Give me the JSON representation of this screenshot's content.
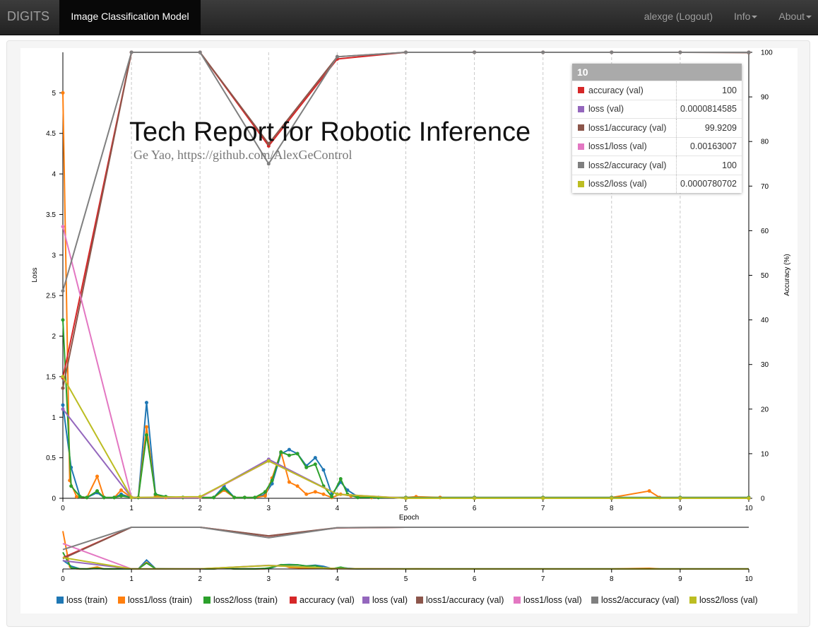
{
  "navbar": {
    "brand": "DIGITS",
    "active_tab": "Image Classification Model",
    "user": "alexge (Logout)",
    "info": "Info",
    "about": "About"
  },
  "overlay": {
    "title": "Tech Report for Robotic Inference",
    "subtitle": "Ge Yao, https://github.com/AlexGeControl"
  },
  "tooltip": {
    "header": "10",
    "rows": [
      {
        "name": "accuracy (val)",
        "value": "100",
        "color": "#d62728"
      },
      {
        "name": "loss (val)",
        "value": "0.0000814585",
        "color": "#9467bd"
      },
      {
        "name": "loss1/accuracy (val)",
        "value": "99.9209",
        "color": "#8c564b"
      },
      {
        "name": "loss1/loss (val)",
        "value": "0.00163007",
        "color": "#e377c2"
      },
      {
        "name": "loss2/accuracy (val)",
        "value": "100",
        "color": "#7f7f7f"
      },
      {
        "name": "loss2/loss (val)",
        "value": "0.0000780702",
        "color": "#bcbd22"
      }
    ]
  },
  "chart_data": {
    "type": "line",
    "xlabel": "Epoch",
    "ylabel": "Loss",
    "y2label": "Accuracy (%)",
    "xlim": [
      0,
      10
    ],
    "ylim": [
      0,
      5.5
    ],
    "y2lim": [
      0,
      100
    ],
    "x_ticks": [
      "0",
      "1",
      "2",
      "3",
      "4",
      "5",
      "6",
      "7",
      "8",
      "9",
      "10"
    ],
    "y_ticks": [
      "0",
      "0.5",
      "1",
      "1.5",
      "2",
      "2.5",
      "3",
      "3.5",
      "4",
      "4.5",
      "5"
    ],
    "y2_ticks": [
      "0",
      "10",
      "20",
      "30",
      "40",
      "50",
      "60",
      "70",
      "80",
      "90",
      "100"
    ],
    "grid": "vertical dashed",
    "legend": "bottom",
    "series": [
      {
        "name": "loss (train)",
        "axis": "left",
        "color": "#1f77b4",
        "x": [
          0,
          0.12,
          0.25,
          0.35,
          0.5,
          0.6,
          0.75,
          0.85,
          1,
          1.1,
          1.22,
          1.35,
          1.5,
          1.75,
          2,
          2.2,
          2.35,
          2.5,
          2.65,
          2.8,
          2.95,
          3.05,
          3.18,
          3.3,
          3.42,
          3.55,
          3.68,
          3.8,
          3.92,
          4.05,
          4.15,
          4.3,
          4.6,
          5,
          5.5,
          6,
          7,
          8,
          9,
          10
        ],
        "y": [
          1.15,
          0.38,
          0.02,
          0.01,
          0.07,
          0.01,
          0.01,
          0.05,
          0.01,
          0.01,
          1.18,
          0.05,
          0.02,
          0.01,
          0.01,
          0.01,
          0.15,
          0.01,
          0.01,
          0.01,
          0.05,
          0.18,
          0.55,
          0.6,
          0.55,
          0.4,
          0.5,
          0.35,
          0.05,
          0.2,
          0.1,
          0.02,
          0.01,
          0.01,
          0.01,
          0.01,
          0.01,
          0.01,
          0.01,
          0.01
        ]
      },
      {
        "name": "loss1/loss (train)",
        "axis": "left",
        "color": "#ff7f0e",
        "x": [
          0,
          0.1,
          0.2,
          0.35,
          0.5,
          0.6,
          0.75,
          0.85,
          1,
          1.1,
          1.22,
          1.35,
          1.5,
          1.75,
          2,
          2.2,
          2.35,
          2.5,
          2.65,
          2.8,
          2.95,
          3.05,
          3.18,
          3.3,
          3.42,
          3.55,
          3.68,
          3.8,
          3.92,
          4.05,
          4.2,
          4.5,
          5,
          5.15,
          5.5,
          6,
          7,
          8,
          8.55,
          8.7,
          9,
          10
        ],
        "y": [
          5,
          0.22,
          0.02,
          0.01,
          0.27,
          0.01,
          0.01,
          0.1,
          0.01,
          0.01,
          0.88,
          0.03,
          0.01,
          0.01,
          0.01,
          0.01,
          0.1,
          0.01,
          0.01,
          0.01,
          0.03,
          0.25,
          0.57,
          0.2,
          0.15,
          0.05,
          0.08,
          0.05,
          0.01,
          0.05,
          0.03,
          0.01,
          0.01,
          0.02,
          0.01,
          0.01,
          0.01,
          0.01,
          0.09,
          0.01,
          0.01,
          0.01
        ]
      },
      {
        "name": "loss2/loss (train)",
        "axis": "left",
        "color": "#2ca02c",
        "x": [
          0,
          0.12,
          0.25,
          0.35,
          0.5,
          0.6,
          0.75,
          0.85,
          1,
          1.1,
          1.22,
          1.35,
          1.5,
          1.75,
          2,
          2.2,
          2.35,
          2.5,
          2.65,
          2.8,
          2.95,
          3.05,
          3.18,
          3.3,
          3.42,
          3.55,
          3.68,
          3.8,
          3.92,
          4.05,
          4.15,
          4.3,
          4.6,
          5,
          6,
          7,
          8,
          9,
          10
        ],
        "y": [
          2.2,
          0.15,
          0.02,
          0.01,
          0.09,
          0.01,
          0.01,
          0.03,
          0.01,
          0.01,
          0.78,
          0.05,
          0.02,
          0.01,
          0.01,
          0.01,
          0.12,
          0.01,
          0.01,
          0.01,
          0.08,
          0.22,
          0.57,
          0.53,
          0.55,
          0.38,
          0.42,
          0.15,
          0.02,
          0.24,
          0.05,
          0.01,
          0.01,
          0.01,
          0.01,
          0.01,
          0.01,
          0.01,
          0.01
        ]
      },
      {
        "name": "accuracy (val)",
        "axis": "right",
        "color": "#d62728",
        "x": [
          0,
          1,
          2,
          3,
          4,
          5,
          6,
          7,
          8,
          9,
          10
        ],
        "y": [
          27,
          100,
          100,
          79,
          98.5,
          100,
          100,
          100,
          100,
          100,
          100
        ]
      },
      {
        "name": "loss (val)",
        "axis": "left",
        "color": "#9467bd",
        "x": [
          0,
          1,
          2,
          3,
          4,
          5,
          6,
          7,
          8,
          9,
          10
        ],
        "y": [
          1.1,
          0.01,
          0.01,
          0.48,
          0.05,
          0.0001,
          0.0001,
          0.0001,
          0.0001,
          0.0001,
          8.14585e-05
        ]
      },
      {
        "name": "loss1/accuracy (val)",
        "axis": "right",
        "color": "#8c564b",
        "x": [
          0,
          1,
          2,
          3,
          4,
          5,
          6,
          7,
          8,
          9,
          10
        ],
        "y": [
          24.7,
          100,
          100,
          79.5,
          99,
          100,
          100,
          100,
          100,
          100,
          99.9209
        ]
      },
      {
        "name": "loss1/loss (val)",
        "axis": "left",
        "color": "#e377c2",
        "x": [
          0,
          1,
          2,
          3,
          4,
          5,
          6,
          7,
          8,
          9,
          10
        ],
        "y": [
          3.35,
          0.01,
          0.01,
          0.46,
          0.05,
          0.002,
          0.002,
          0.002,
          0.002,
          0.002,
          0.00163007
        ]
      },
      {
        "name": "loss2/accuracy (val)",
        "axis": "right",
        "color": "#7f7f7f",
        "x": [
          0,
          1,
          2,
          3,
          4,
          5,
          6,
          7,
          8,
          9,
          10
        ],
        "y": [
          46.5,
          100,
          100,
          75,
          99,
          100,
          100,
          100,
          100,
          100,
          100
        ]
      },
      {
        "name": "loss2/loss (val)",
        "axis": "left",
        "color": "#bcbd22",
        "x": [
          0,
          1,
          2,
          3,
          4,
          5,
          6,
          7,
          8,
          9,
          10
        ],
        "y": [
          1.5,
          0.01,
          0.02,
          0.46,
          0.05,
          0.0001,
          0.0001,
          0.0001,
          0.0001,
          0.0001,
          7.80702e-05
        ]
      }
    ]
  }
}
